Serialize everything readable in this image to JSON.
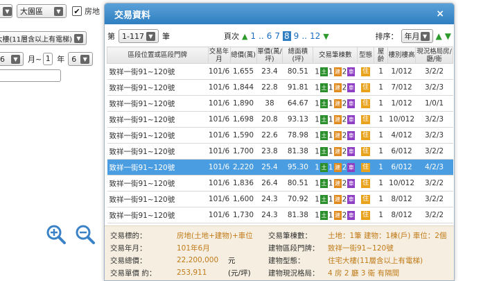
{
  "background": {
    "county_select": "大園區",
    "house_land_checkbox_label": "房地",
    "building_type_select": "住宅大樓(11層含以上有電梯)",
    "date_from_month": "6",
    "month_label": "月~",
    "date_to_year": "1",
    "year_label": "年",
    "date_to_month": "6"
  },
  "modal": {
    "title": "交易資料",
    "close_icon": "×",
    "page_prefix": "第",
    "page_select": "1-117",
    "page_suffix": "筆",
    "pager_label": "頁次",
    "pager_pages": [
      "1",
      "..",
      "6",
      "7",
      "8",
      "9",
      "..",
      "12"
    ],
    "pager_current": "8",
    "sort_label": "排序：",
    "sort_select": "年月"
  },
  "table": {
    "headers": [
      "區段位置或區段門牌",
      "交易年月",
      "總價(萬)",
      "單價(萬/坪)",
      "總面積(坪)",
      "交易筆棟數",
      "型態",
      "屋齡",
      "樓別樓高",
      "現況格局房/廳/衛"
    ],
    "rows": [
      {
        "addr": "致祥一街91~120號",
        "ym": "101/6",
        "total": "1,655",
        "unit": "23.4",
        "area": "80.51",
        "age": "1",
        "floor": "1/012",
        "layout": "3/2/2"
      },
      {
        "addr": "致祥一街91~120號",
        "ym": "101/6",
        "total": "1,844",
        "unit": "22.8",
        "area": "91.81",
        "age": "1",
        "floor": "7/012",
        "layout": "3/2/3"
      },
      {
        "addr": "致祥一街91~120號",
        "ym": "101/6",
        "total": "1,890",
        "unit": "38",
        "area": "64.67",
        "age": "1",
        "floor": "1/012",
        "layout": "1/0/1"
      },
      {
        "addr": "致祥一街91~120號",
        "ym": "101/6",
        "total": "1,698",
        "unit": "20.8",
        "area": "93.13",
        "age": "1",
        "floor": "10/012",
        "layout": "3/2/3"
      },
      {
        "addr": "致祥一街91~120號",
        "ym": "101/6",
        "total": "1,590",
        "unit": "22.6",
        "area": "78.98",
        "age": "1",
        "floor": "4/012",
        "layout": "3/2/3"
      },
      {
        "addr": "致祥一街91~120號",
        "ym": "101/6",
        "total": "1,700",
        "unit": "23.8",
        "area": "81.38",
        "age": "1",
        "floor": "6/012",
        "layout": "3/2/2"
      },
      {
        "addr": "致祥一街91~120號",
        "ym": "101/6",
        "total": "2,220",
        "unit": "25.4",
        "area": "95.30",
        "age": "1",
        "floor": "6/012",
        "layout": "4/2/3"
      },
      {
        "addr": "致祥一街91~120號",
        "ym": "101/6",
        "total": "1,836",
        "unit": "26.4",
        "area": "80.51",
        "age": "1",
        "floor": "10/012",
        "layout": "3/2/2"
      },
      {
        "addr": "致祥一街91~120號",
        "ym": "101/6",
        "total": "1,600",
        "unit": "24.3",
        "area": "70.92",
        "age": "1",
        "floor": "8/012",
        "layout": "3/2/2"
      },
      {
        "addr": "致祥一街91~120號",
        "ym": "101/6",
        "total": "1,730",
        "unit": "24.3",
        "area": "81.38",
        "age": "1",
        "floor": "8/012",
        "layout": "3/2/2"
      }
    ],
    "selected_row": 6,
    "tag_counts": {
      "land": "1",
      "building": "1",
      "car": "2"
    },
    "tag_labels": {
      "land": "土",
      "building": "建",
      "car": "車",
      "type": "住"
    }
  },
  "detail": {
    "left": [
      {
        "label": "交易標的：",
        "value": "房地(土地+建物)+車位",
        "unit": ""
      },
      {
        "label": "交易年月：",
        "value": "101年6月",
        "unit": ""
      },
      {
        "label": "交易總價：",
        "value": "22,200,000",
        "unit": "元"
      },
      {
        "label": "交易單價 約：",
        "value": "253,911",
        "unit": "(元/坪)"
      }
    ],
    "right": [
      {
        "label": "交易筆棟數：",
        "value": "土地：1筆 建物：1棟(戶) 車位：2個"
      },
      {
        "label": "建物區段門牌：",
        "value": "致祥一街91~120號"
      },
      {
        "label": "建物型態：",
        "value": "住宅大樓(11層含以上有電梯)"
      },
      {
        "label": "建物現況格局：",
        "value": "4 房 2 廳 3 衛 有隔間"
      }
    ]
  },
  "colors": {
    "header_blue": "#2f7fc1",
    "selected_row": "#4a9de0",
    "detail_bg": "#f6efe1",
    "value_orange": "#c07a18"
  }
}
